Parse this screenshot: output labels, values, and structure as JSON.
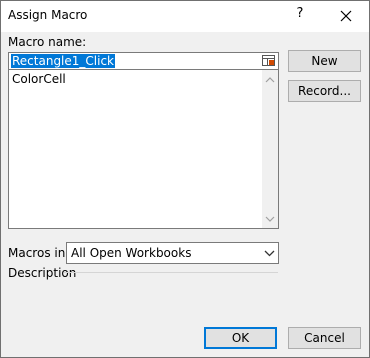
{
  "window": {
    "title": "Assign Macro",
    "help": "?"
  },
  "macro_name": {
    "label": "Macro name:",
    "value": "Rectangle1_Click"
  },
  "macro_list": {
    "items": [
      "ColorCell"
    ]
  },
  "buttons": {
    "new": "New",
    "record": "Record...",
    "ok": "OK",
    "cancel": "Cancel"
  },
  "macros_in": {
    "label": "Macros in:",
    "value": "All Open Workbooks"
  },
  "description": {
    "label": "Description"
  },
  "colors": {
    "accent": "#0078d7",
    "selection": "#0078d7",
    "face": "#f0f0f0"
  }
}
